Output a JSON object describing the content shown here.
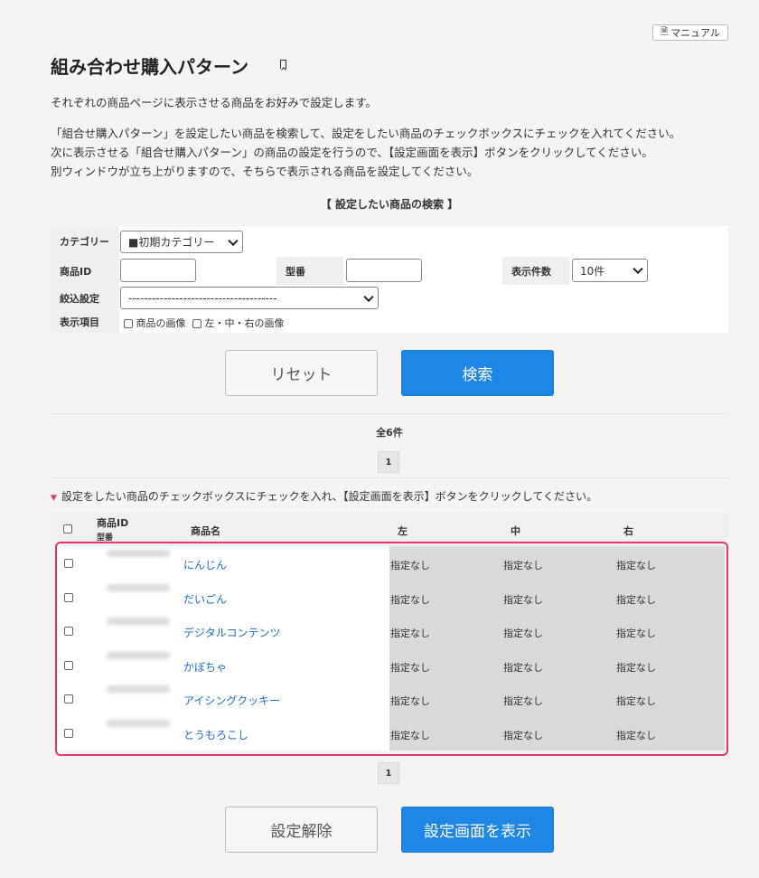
{
  "manual_label": "マニュアル",
  "page_title": "組み合わせ購入パターン",
  "description": [
    "それぞれの商品ページに表示させる商品をお好みで設定します。",
    "「組合せ購入パターン」を設定したい商品を検索して、設定をしたい商品のチェックボックスにチェックを入れてください。",
    "次に表示させる「組合せ購入パターン」の商品の設定を行うので、【設定画面を表示】ボタンをクリックしてください。",
    "別ウィンドウが立ち上がりますので、そちらで表示される商品を設定してください。"
  ],
  "search": {
    "section_title": "【 設定したい商品の検索 】",
    "category_label": "カテゴリー",
    "category_value": "■初期カテゴリー",
    "product_id_label": "商品ID",
    "product_id_value": "",
    "model_label": "型番",
    "model_value": "",
    "per_page_label": "表示件数",
    "per_page_value": "10件",
    "filter_label": "絞込設定",
    "filter_value": "--------------------------------------",
    "display_label": "表示項目",
    "display_opt1": "商品の画像",
    "display_opt2": "左・中・右の画像",
    "reset_button": "リセット",
    "search_button": "検索"
  },
  "results": {
    "total": "全6件",
    "page": "1",
    "instruction": "設定をしたい商品のチェックボックスにチェックを入れ、【設定画面を表示】ボタンをクリックしてください。",
    "columns": {
      "id": "商品ID",
      "model": "型番",
      "name": "商品名",
      "left": "左",
      "center": "中",
      "right": "右"
    },
    "rows": [
      {
        "name": "にんじん",
        "left": "指定なし",
        "center": "指定なし",
        "right": "指定なし"
      },
      {
        "name": "だいごん",
        "left": "指定なし",
        "center": "指定なし",
        "right": "指定なし"
      },
      {
        "name": "デジタルコンテンツ",
        "left": "指定なし",
        "center": "指定なし",
        "right": "指定なし"
      },
      {
        "name": "かぼちゃ",
        "left": "指定なし",
        "center": "指定なし",
        "right": "指定なし"
      },
      {
        "name": "アイシングクッキー",
        "left": "指定なし",
        "center": "指定なし",
        "right": "指定なし"
      },
      {
        "name": "とうもろこし",
        "left": "指定なし",
        "center": "指定なし",
        "right": "指定なし"
      }
    ],
    "page_bottom": "1",
    "clear_button": "設定解除",
    "show_settings_button": "設定画面を表示"
  },
  "colors": {
    "accent_blue": "#1d86e6",
    "highlight_pink": "#e8356c",
    "link_blue": "#1a6fc4"
  }
}
